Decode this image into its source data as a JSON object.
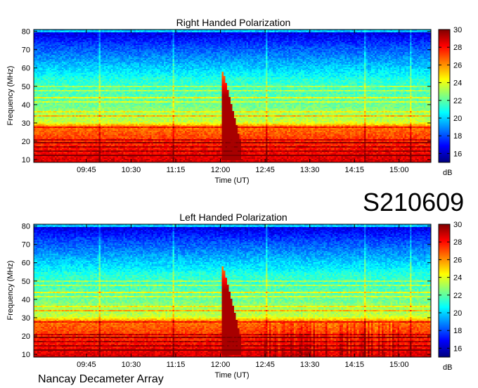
{
  "figure_id": "S210609",
  "footer": "Nancay Decameter Array",
  "colors": {
    "colormap": [
      "#00007f",
      "#0000ff",
      "#0080ff",
      "#00ffff",
      "#80ff80",
      "#ffff00",
      "#ff8000",
      "#ff0000",
      "#7f0000"
    ]
  },
  "chart_data": [
    {
      "type": "heatmap",
      "title": "Right Handed Polarization",
      "xlabel": "Time (UT)",
      "ylabel": "Frequency (MHz)",
      "x_ticks": [
        "09:45",
        "10:30",
        "11:15",
        "12:00",
        "12:45",
        "13:30",
        "14:15",
        "15:00"
      ],
      "x_tick_minutes": [
        585,
        630,
        675,
        720,
        765,
        810,
        855,
        900
      ],
      "xlim_minutes": [
        532,
        932
      ],
      "y_ticks": [
        "10",
        "20",
        "30",
        "40",
        "50",
        "60",
        "70",
        "80"
      ],
      "y_tick_values": [
        10,
        20,
        30,
        40,
        50,
        60,
        70,
        80
      ],
      "ylim": [
        8.5,
        81
      ],
      "colorbar": {
        "label": "dB",
        "ticks": [
          "16",
          "18",
          "20",
          "22",
          "24",
          "26",
          "28",
          "30"
        ],
        "range": [
          15,
          30
        ]
      },
      "event": {
        "type": "solar radio burst",
        "start_time": "12:00",
        "start_minute": 723,
        "freq_range_mhz": [
          10,
          58
        ]
      }
    },
    {
      "type": "heatmap",
      "title": "Left Handed Polarization",
      "xlabel": "Time (UT)",
      "ylabel": "Frequency (MHz)",
      "x_ticks": [
        "09:45",
        "10:30",
        "11:15",
        "12:00",
        "12:45",
        "13:30",
        "14:15",
        "15:00"
      ],
      "x_tick_minutes": [
        585,
        630,
        675,
        720,
        765,
        810,
        855,
        900
      ],
      "xlim_minutes": [
        532,
        932
      ],
      "y_ticks": [
        "10",
        "20",
        "30",
        "40",
        "50",
        "60",
        "70",
        "80"
      ],
      "y_tick_values": [
        10,
        20,
        30,
        40,
        50,
        60,
        70,
        80
      ],
      "ylim": [
        8.5,
        81
      ],
      "colorbar": {
        "label": "dB",
        "ticks": [
          "16",
          "18",
          "20",
          "22",
          "24",
          "26",
          "28",
          "30"
        ],
        "range": [
          15,
          30
        ]
      },
      "event": {
        "type": "solar radio burst",
        "start_time": "12:00",
        "start_minute": 723,
        "freq_range_mhz": [
          10,
          58
        ]
      }
    }
  ]
}
